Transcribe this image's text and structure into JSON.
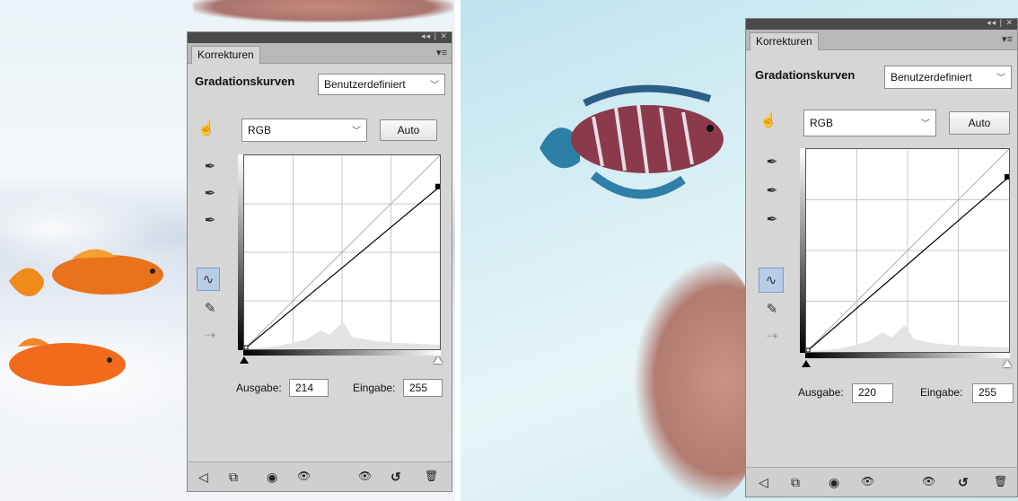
{
  "colors": {
    "panel_bg": "#d6d6d6",
    "titlebar": "#4a4a4a",
    "active_tool": "#b7cde6"
  },
  "panels": [
    {
      "window_controls": "◂◂ | ✕",
      "tab_label": "Korrekturen",
      "tab_menu_icon": "▾≡",
      "title": "Gradationskurven",
      "preset_value": "Benutzerdefiniert",
      "channel_value": "RGB",
      "auto_label": "Auto",
      "output_label": "Ausgabe:",
      "output_value": "214",
      "input_label": "Eingabe:",
      "input_value": "255",
      "curve_end_output": 214
    },
    {
      "window_controls": "◂◂ | ✕",
      "tab_label": "Korrekturen",
      "tab_menu_icon": "▾≡",
      "title": "Gradationskurven",
      "preset_value": "Benutzerdefiniert",
      "channel_value": "RGB",
      "auto_label": "Auto",
      "output_label": "Ausgabe:",
      "output_value": "220",
      "input_label": "Eingabe:",
      "input_value": "255",
      "curve_end_output": 220
    }
  ],
  "icons": {
    "on_image_adjust": "☝",
    "eyedropper": "✒",
    "curve_point": "∿",
    "pencil": "✎",
    "smooth": "⇢",
    "back": "◁",
    "clip": "⧉",
    "view_prev": "◉",
    "visibility": "👁",
    "reset": "↺",
    "delete": "🗑"
  }
}
